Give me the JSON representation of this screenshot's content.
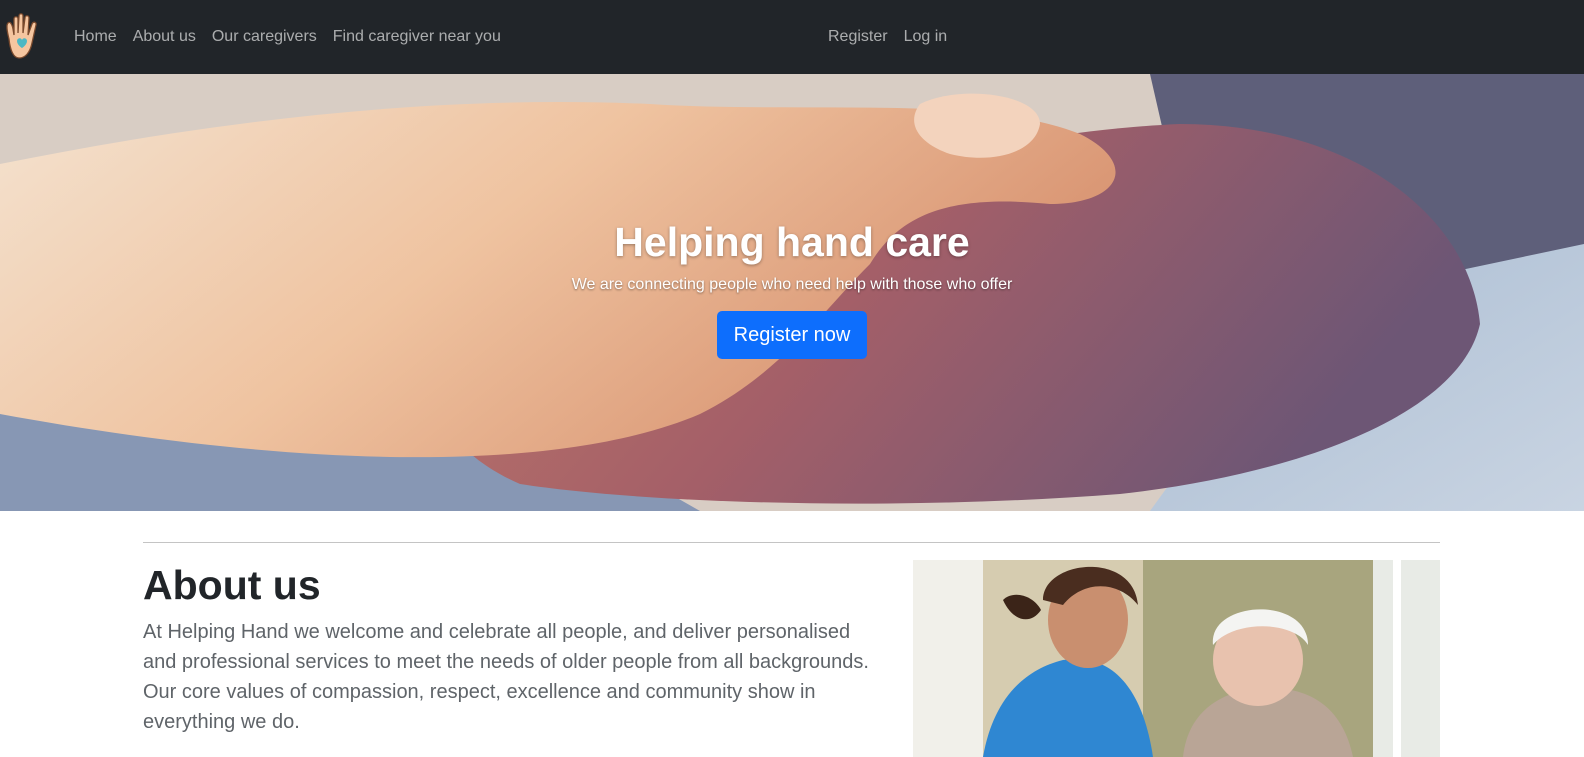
{
  "nav": {
    "brand_icon": "helping-hand-logo-icon",
    "left_links": [
      "Home",
      "About us",
      "Our caregivers",
      "Find caregiver near you"
    ],
    "right_links": [
      "Register",
      "Log in"
    ]
  },
  "hero": {
    "title": "Helping hand care",
    "subtitle": "We are connecting people who need help with those who offer",
    "button_label": "Register now"
  },
  "about": {
    "title": "About us",
    "text": "At Helping Hand we welcome and celebrate all people, and deliver personalised and professional services to meet the needs of older people from all backgrounds. Our core values of compassion, respect, excellence and community show in everything we do."
  },
  "colors": {
    "navbar_bg": "#212529",
    "nav_link": "rgba(255,255,255,0.62)",
    "primary_button": "#0d6efd",
    "logo_hand": "#f5c6a0",
    "logo_heart": "#4cb8c4"
  }
}
